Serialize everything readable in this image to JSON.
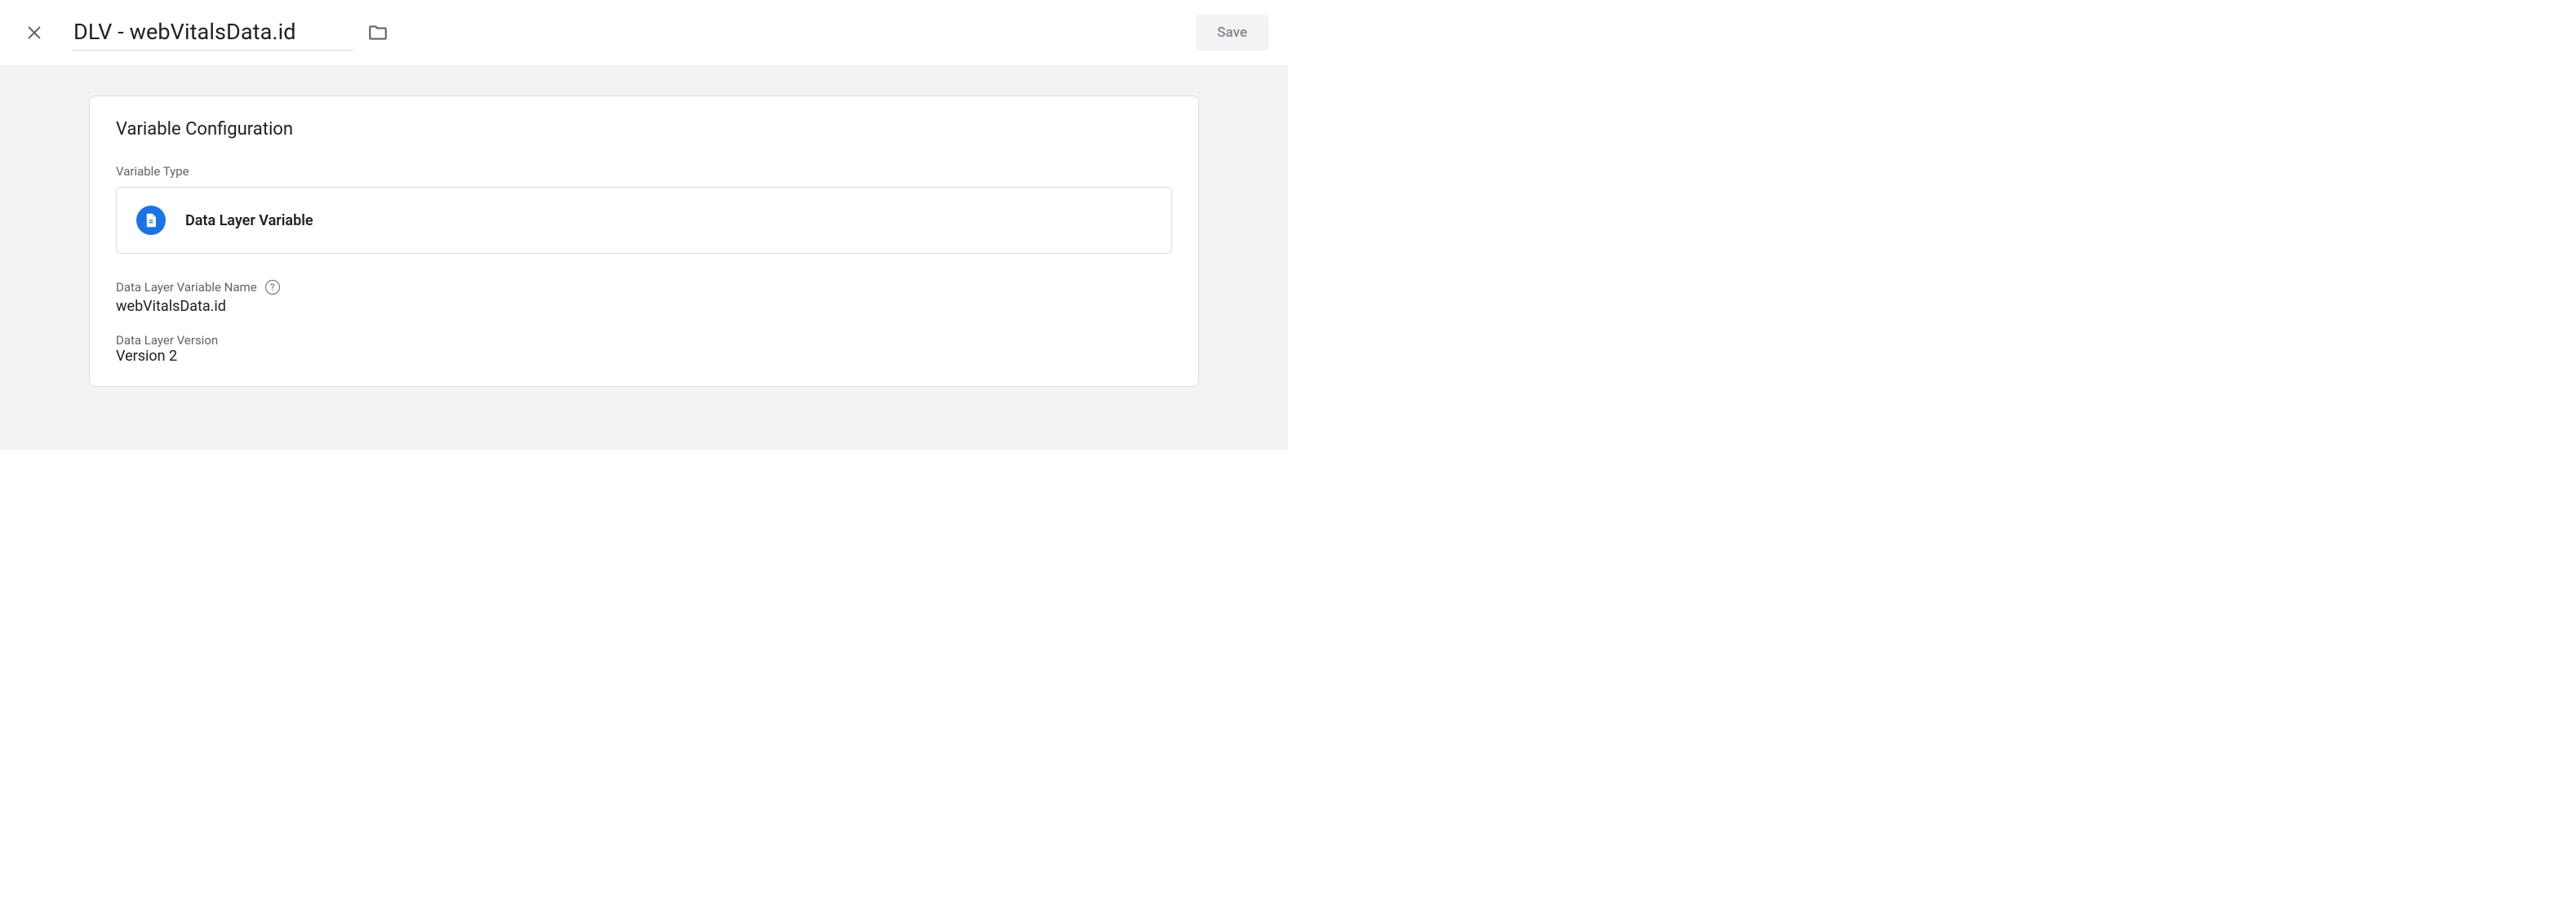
{
  "header": {
    "title": "DLV - webVitalsData.id",
    "save_label": "Save"
  },
  "config": {
    "card_title": "Variable Configuration",
    "type_label": "Variable Type",
    "type_value": "Data Layer Variable",
    "fields": {
      "name_label": "Data Layer Variable Name",
      "name_value": "webVitalsData.id",
      "version_label": "Data Layer Version",
      "version_value": "Version 2"
    }
  }
}
